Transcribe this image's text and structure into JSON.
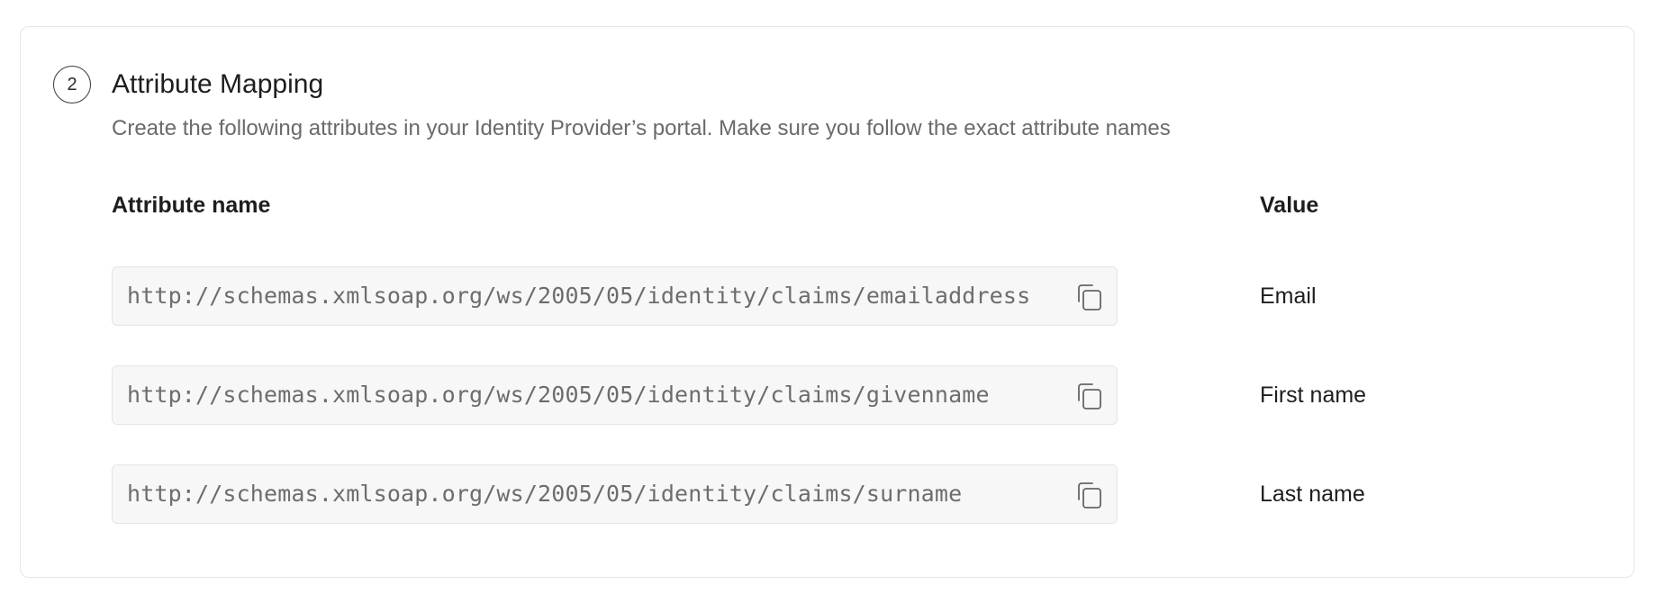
{
  "section": {
    "step_number": "2",
    "title": "Attribute Mapping",
    "description": "Create the following attributes in your Identity Provider’s portal. Make sure you follow the exact attribute names"
  },
  "table": {
    "headers": {
      "attribute_name": "Attribute name",
      "value": "Value"
    },
    "rows": [
      {
        "attribute": "http://schemas.xmlsoap.org/ws/2005/05/identity/claims/emailaddress",
        "value": "Email",
        "copy_icon": "copy-icon"
      },
      {
        "attribute": "http://schemas.xmlsoap.org/ws/2005/05/identity/claims/givenname",
        "value": "First name",
        "copy_icon": "copy-icon"
      },
      {
        "attribute": "http://schemas.xmlsoap.org/ws/2005/05/identity/claims/surname",
        "value": "Last name",
        "copy_icon": "copy-icon"
      }
    ]
  },
  "colors": {
    "field_background": "#f7f7f7",
    "border": "#e5e5e5",
    "text_primary": "#1e1e1e",
    "text_secondary": "#6a6a6a"
  }
}
